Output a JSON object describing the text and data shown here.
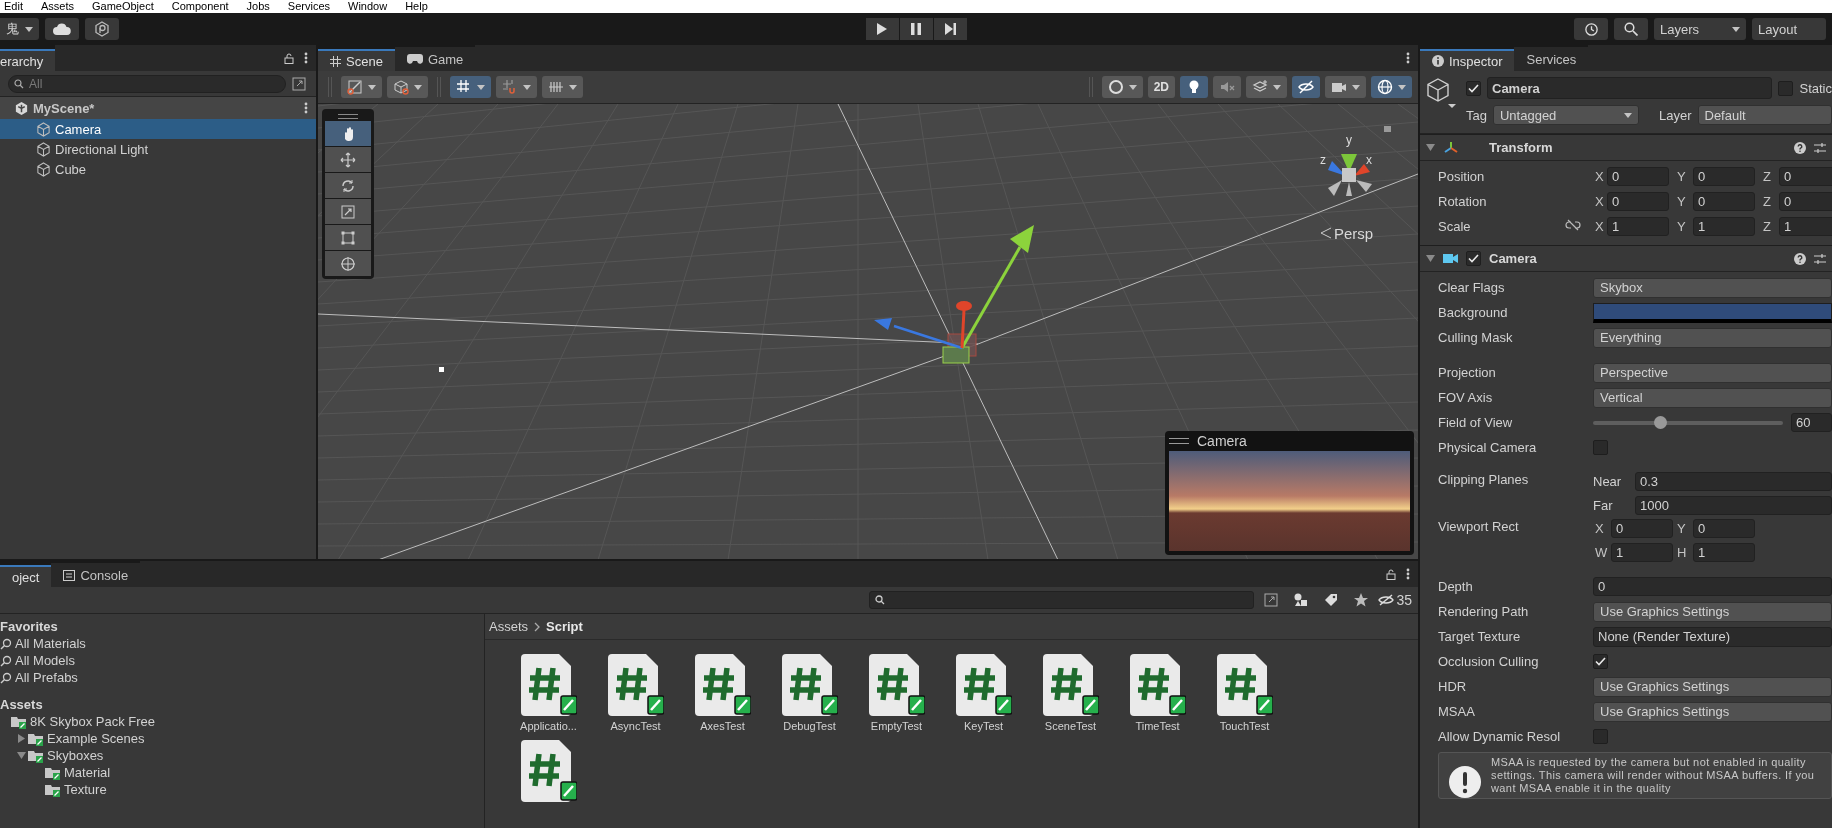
{
  "menu": [
    "Edit",
    "Assets",
    "GameObject",
    "Component",
    "Jobs",
    "Services",
    "Window",
    "Help"
  ],
  "toolbar": {
    "account": "鬼",
    "layers": "Layers",
    "layout": "Layout"
  },
  "hierarchy": {
    "tab": "erarchy",
    "search_placeholder": "All",
    "scene": "MyScene*",
    "items": [
      {
        "label": "Camera",
        "selected": true
      },
      {
        "label": "Directional Light",
        "selected": false
      },
      {
        "label": "Cube",
        "selected": false
      }
    ]
  },
  "scene": {
    "tabs": [
      {
        "label": "Scene",
        "selected": true
      },
      {
        "label": "Game",
        "selected": false
      }
    ],
    "toolbar_left": [
      {
        "on": false,
        "dropdown": true
      },
      {
        "on": false,
        "dropdown": true
      },
      {
        "on": true,
        "dropdown": true
      },
      {
        "on": false,
        "dropdown": true
      },
      {
        "on": false,
        "dropdown": true
      }
    ],
    "toolbar_right": [
      {
        "on": false,
        "dropdown": true
      },
      {
        "label": "2D",
        "on": false,
        "dropdown": false
      },
      {
        "on": true,
        "dropdown": false
      },
      {
        "on": false,
        "dropdown": false
      },
      {
        "on": false,
        "dropdown": true
      },
      {
        "on": true,
        "dropdown": false
      },
      {
        "on": false,
        "dropdown": true
      },
      {
        "on": true,
        "dropdown": true
      }
    ],
    "tools": [
      {
        "selected": true
      },
      {
        "selected": false
      },
      {
        "selected": false
      },
      {
        "selected": false
      },
      {
        "selected": false
      },
      {
        "selected": false
      }
    ],
    "axes": [
      "y",
      "x",
      "z"
    ],
    "view_mode": "Persp",
    "preview_title": "Camera"
  },
  "inspector": {
    "tabs": [
      {
        "label": "Inspector",
        "selected": true
      },
      {
        "label": "Services",
        "selected": false
      }
    ],
    "object": {
      "active": true,
      "name": "Camera",
      "static": false,
      "static_label": "Static",
      "tag_label": "Tag",
      "tag": "Untagged",
      "layer_label": "Layer",
      "layer": "Default"
    },
    "transform": {
      "title": "Transform",
      "expanded": true,
      "rows": [
        {
          "label": "Position",
          "kind": "vector",
          "values": [
            {
              "axis": "X",
              "value": "0"
            },
            {
              "axis": "Y",
              "value": "0"
            },
            {
              "axis": "Z",
              "value": "0"
            }
          ]
        },
        {
          "label": "Rotation",
          "kind": "vector",
          "values": [
            {
              "axis": "X",
              "value": "0"
            },
            {
              "axis": "Y",
              "value": "0"
            },
            {
              "axis": "Z",
              "value": "0"
            }
          ]
        },
        {
          "label": "Scale",
          "kind": "vector-link",
          "values": [
            {
              "axis": "X",
              "value": "1"
            },
            {
              "axis": "Y",
              "value": "1"
            },
            {
              "axis": "Z",
              "value": "1"
            }
          ]
        }
      ]
    },
    "camera": {
      "title": "Camera",
      "expanded": true,
      "enabled": true,
      "groups": [
        [
          {
            "label": "Clear Flags",
            "kind": "dropdown",
            "value": "Skybox"
          },
          {
            "label": "Background",
            "kind": "color",
            "color": "#2f4b7a"
          },
          {
            "label": "Culling Mask",
            "kind": "dropdown",
            "value": "Everything"
          }
        ],
        [
          {
            "label": "Projection",
            "kind": "dropdown",
            "value": "Perspective"
          },
          {
            "label": "FOV Axis",
            "kind": "dropdown",
            "value": "Vertical"
          },
          {
            "label": "Field of View",
            "kind": "slider",
            "level": 0.35,
            "value": "60"
          },
          {
            "label": "Physical Camera",
            "kind": "checkbox",
            "checked": false
          }
        ],
        [
          {
            "label": "Clipping Planes",
            "kind": "planes",
            "fields": [
              {
                "label": "Near",
                "value": "0.3"
              },
              {
                "label": "Far",
                "value": "1000"
              }
            ]
          },
          {
            "label": "Viewport Rect",
            "kind": "rect",
            "fields": [
              {
                "label": "X",
                "value": "0"
              },
              {
                "label": "Y",
                "value": "0"
              },
              {
                "label": "W",
                "value": "1"
              },
              {
                "label": "H",
                "value": "1"
              }
            ]
          }
        ],
        [
          {
            "label": "Depth",
            "kind": "field",
            "value": "0"
          },
          {
            "label": "Rendering Path",
            "kind": "dropdown",
            "value": "Use Graphics Settings"
          },
          {
            "label": "Target Texture",
            "kind": "object",
            "value": "None (Render Texture)"
          },
          {
            "label": "Occlusion Culling",
            "kind": "checkbox",
            "checked": true
          },
          {
            "label": "HDR",
            "kind": "dropdown",
            "value": "Use Graphics Settings"
          },
          {
            "label": "MSAA",
            "kind": "dropdown",
            "value": "Use Graphics Settings"
          },
          {
            "label": "Allow Dynamic Resol",
            "kind": "checkbox",
            "checked": false
          }
        ]
      ],
      "warning": "MSAA is requested by the camera but not enabled in quality settings. This camera will render without MSAA buffers. If you want MSAA enable it in the quality"
    }
  },
  "project": {
    "tabs": [
      {
        "label": "oject",
        "selected": true
      },
      {
        "label": "Console",
        "selected": false
      }
    ],
    "hidden_count": "35",
    "favorites": {
      "title": "Favorites",
      "items": [
        "All Materials",
        "All Models",
        "All Prefabs"
      ]
    },
    "assets": {
      "title": "Assets",
      "tree": [
        {
          "label": "8K Skybox Pack Free",
          "children": [
            {
              "label": "Example Scenes",
              "expanded": false
            },
            {
              "label": "Skyboxes",
              "expanded": true,
              "children": [
                {
                  "label": "Material"
                },
                {
                  "label": "Texture"
                }
              ]
            }
          ]
        }
      ]
    },
    "breadcrumb": [
      "Assets",
      "Script"
    ],
    "files": [
      {
        "kind": "file",
        "label": "Applicatio..."
      },
      {
        "kind": "file",
        "label": "AsyncTest"
      },
      {
        "kind": "file",
        "label": "AxesTest"
      },
      {
        "kind": "file",
        "label": "DebugTest"
      },
      {
        "kind": "file",
        "label": "EmptyTest"
      },
      {
        "kind": "file",
        "label": "KeyTest"
      },
      {
        "kind": "file",
        "label": "SceneTest"
      },
      {
        "kind": "file",
        "label": "TimeTest"
      },
      {
        "kind": "file",
        "label": "TouchTest"
      },
      {
        "kind": "unlabeled"
      }
    ]
  }
}
